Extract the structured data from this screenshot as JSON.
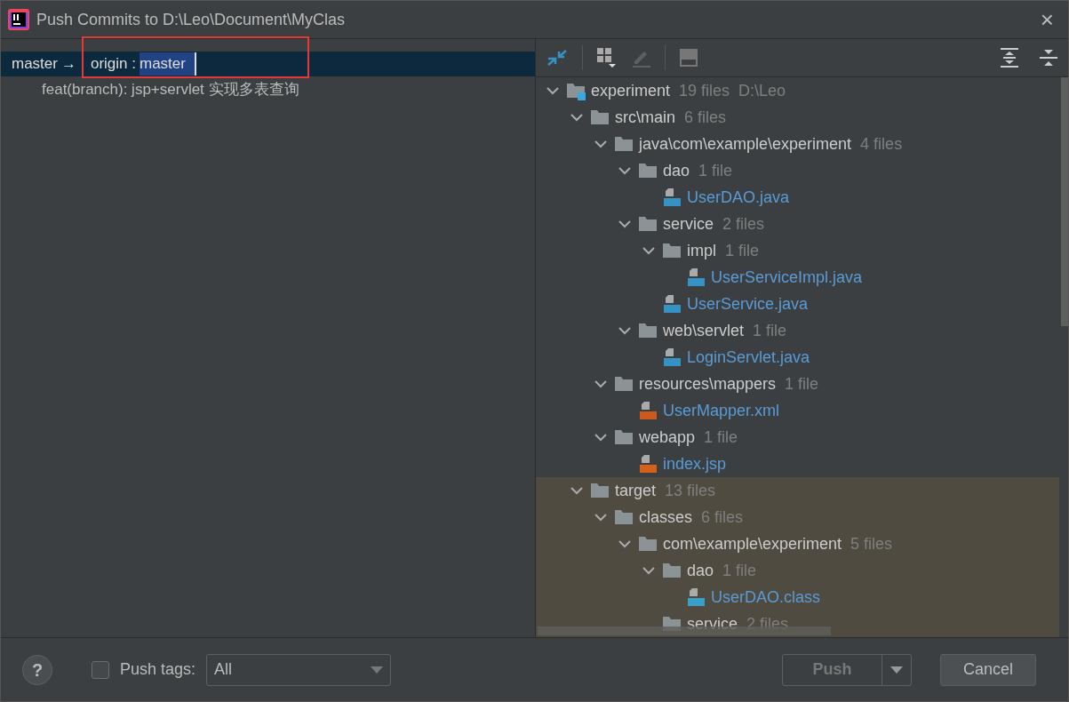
{
  "window": {
    "title": "Push Commits to D:\\Leo\\Document\\MyClas",
    "close": "×"
  },
  "branch": {
    "local": "master",
    "arrow": "→",
    "remote": "origin :",
    "target": "master"
  },
  "commits": [
    {
      "message": "feat(branch): jsp+servlet 实现多表查询",
      "selected": false
    }
  ],
  "tree": [
    {
      "kind": "module",
      "name": "experiment",
      "count": "19 files",
      "path": "D:\\Leo",
      "ignored": false,
      "children": [
        {
          "kind": "folder",
          "name": "src\\main",
          "count": "6 files",
          "ignored": false,
          "children": [
            {
              "kind": "folder",
              "name": "java\\com\\example\\experiment",
              "count": "4 files",
              "ignored": false,
              "children": [
                {
                  "kind": "folder",
                  "name": "dao",
                  "count": "1 file",
                  "ignored": false,
                  "children": [
                    {
                      "kind": "java",
                      "name": "UserDAO.java",
                      "ignored": false
                    }
                  ]
                },
                {
                  "kind": "folder",
                  "name": "service",
                  "count": "2 files",
                  "ignored": false,
                  "children": [
                    {
                      "kind": "folder",
                      "name": "impl",
                      "count": "1 file",
                      "ignored": false,
                      "children": [
                        {
                          "kind": "java",
                          "name": "UserServiceImpl.java",
                          "ignored": false
                        }
                      ]
                    },
                    {
                      "kind": "java",
                      "name": "UserService.java",
                      "ignored": false
                    }
                  ]
                },
                {
                  "kind": "folder",
                  "name": "web\\servlet",
                  "count": "1 file",
                  "ignored": false,
                  "children": [
                    {
                      "kind": "java",
                      "name": "LoginServlet.java",
                      "ignored": false
                    }
                  ]
                }
              ]
            },
            {
              "kind": "folder",
              "name": "resources\\mappers",
              "count": "1 file",
              "ignored": false,
              "children": [
                {
                  "kind": "xml",
                  "name": "UserMapper.xml",
                  "ignored": false
                }
              ]
            },
            {
              "kind": "folder",
              "name": "webapp",
              "count": "1 file",
              "ignored": false,
              "children": [
                {
                  "kind": "jsp",
                  "name": "index.jsp",
                  "ignored": false
                }
              ]
            }
          ]
        },
        {
          "kind": "folder",
          "name": "target",
          "count": "13 files",
          "ignored": true,
          "children": [
            {
              "kind": "folder",
              "name": "classes",
              "count": "6 files",
              "ignored": true,
              "children": [
                {
                  "kind": "folder",
                  "name": "com\\example\\experiment",
                  "count": "5 files",
                  "ignored": true,
                  "children": [
                    {
                      "kind": "folder",
                      "name": "dao",
                      "count": "1 file",
                      "ignored": true,
                      "children": [
                        {
                          "kind": "class",
                          "name": "UserDAO.class",
                          "ignored": true
                        }
                      ]
                    },
                    {
                      "kind": "folder",
                      "name": "service",
                      "count": "2 files",
                      "ignored": true
                    }
                  ]
                }
              ]
            }
          ]
        }
      ]
    }
  ],
  "footer": {
    "help": "?",
    "push_tags": {
      "label": "Push tags:",
      "checked": false
    },
    "tags_dropdown": {
      "value": "All"
    },
    "buttons": [
      {
        "label": "Push",
        "kind": "split"
      },
      {
        "label": "Cancel",
        "kind": "plain"
      }
    ]
  }
}
